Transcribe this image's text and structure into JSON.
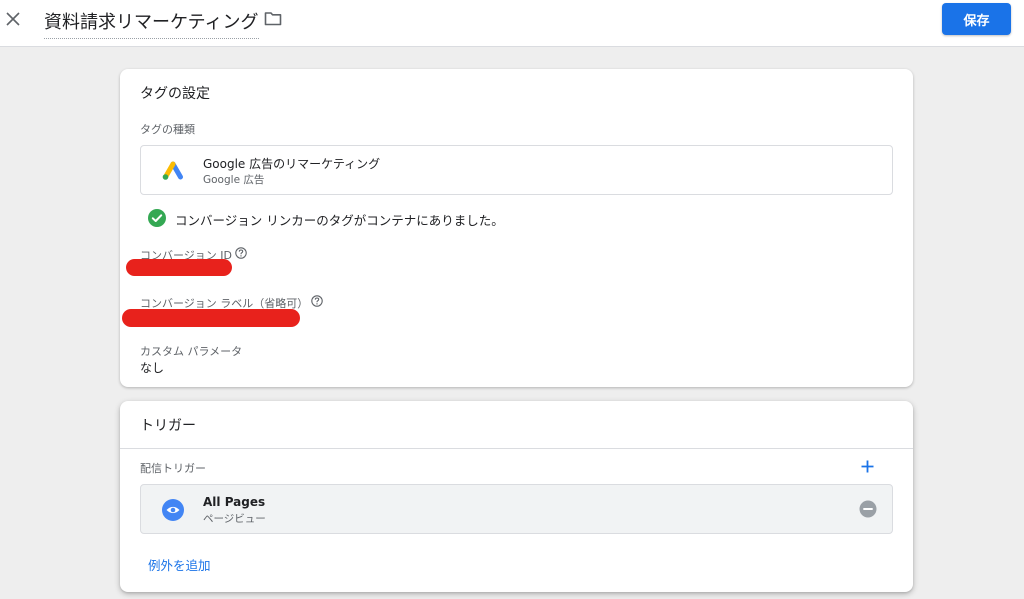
{
  "header": {
    "title": "資料請求リマーケティング",
    "save_label": "保存"
  },
  "tag_config": {
    "title": "タグの設定",
    "tag_type_label": "タグの種類",
    "tag_type_name": "Google 広告のリマーケティング",
    "tag_type_vendor": "Google 広告",
    "linker_status": "コンバージョン リンカーのタグがコンテナにありました。",
    "conversion_id_label": "コンバージョン ID",
    "conversion_label_label": "コンバージョン ラベル（省略可）",
    "custom_params_label": "カスタム パラメータ",
    "custom_params_value": "なし"
  },
  "triggers": {
    "title": "トリガー",
    "firing_label": "配信トリガー",
    "items": [
      {
        "name": "All Pages",
        "type": "ページビュー"
      }
    ],
    "add_exception_label": "例外を追加"
  },
  "colors": {
    "accent": "#1a73e8",
    "success": "#34a853",
    "redaction": "#e8221c"
  },
  "icons": {
    "close": "close-icon",
    "folder": "folder-icon",
    "tag_type": "google-ads-logo-icon",
    "success": "check-circle-icon",
    "help": "help-circle-icon",
    "add": "plus-icon",
    "trigger": "eye-icon",
    "remove": "remove-circle-icon"
  }
}
